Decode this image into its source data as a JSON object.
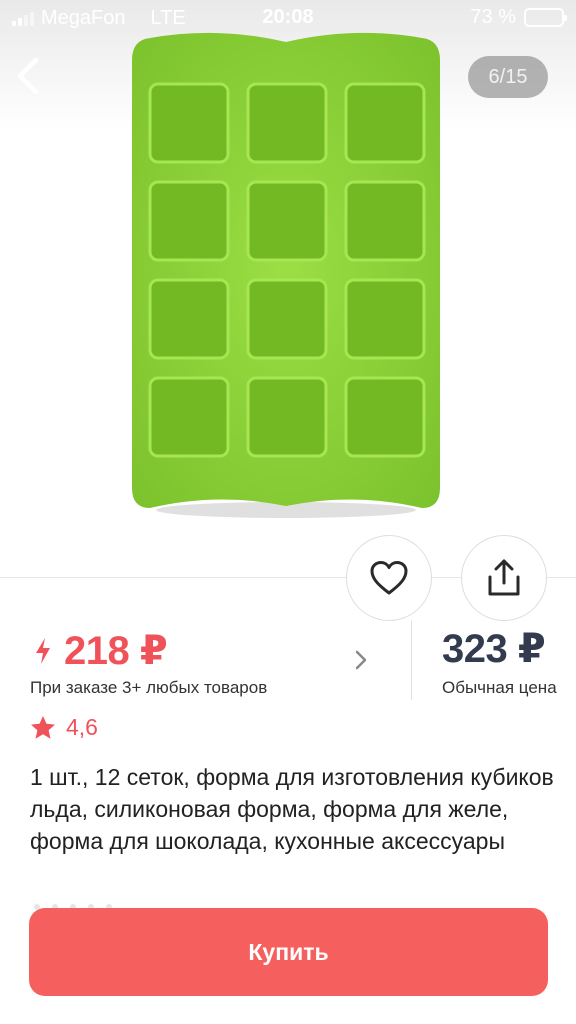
{
  "status_bar": {
    "carrier": "MegaFon",
    "network": "LTE",
    "time": "20:08",
    "battery": "73 %",
    "battery_level": 0.73
  },
  "gallery": {
    "counter": "6/15",
    "product_color": "#8fd43a"
  },
  "price": {
    "promo_amount": "218 ₽",
    "promo_caption": "При заказе 3+ любых товаров",
    "regular_amount": "323 ₽",
    "regular_caption": "Обычная цена"
  },
  "rating": {
    "value": "4,6"
  },
  "product": {
    "title": "1 шт., 12 сеток, форма для изготовления кубиков льда, силиконовая форма, форма для желе, форма для шоколада, кухонные аксессуары"
  },
  "actions": {
    "buy_label": "Купить"
  },
  "colors": {
    "accent": "#f0525a",
    "buy_button": "#f5605f",
    "regular_price": "#333c4e"
  },
  "icons": [
    "chevron-left-icon",
    "heart-icon",
    "share-icon",
    "lightning-icon",
    "chevron-right-icon",
    "star-icon"
  ]
}
